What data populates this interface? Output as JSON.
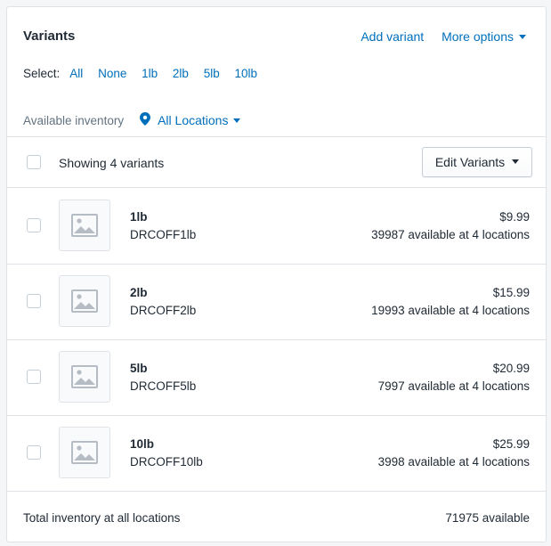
{
  "header": {
    "title": "Variants",
    "add_variant": "Add variant",
    "more_options": "More options"
  },
  "select": {
    "label": "Select:",
    "options": [
      "All",
      "None",
      "1lb",
      "2lb",
      "5lb",
      "10lb"
    ]
  },
  "inventory": {
    "label": "Available inventory",
    "location": "All Locations"
  },
  "list": {
    "showing": "Showing 4 variants",
    "edit_button": "Edit Variants"
  },
  "variants": [
    {
      "name": "1lb",
      "sku": "DRCOFF1lb",
      "price": "$9.99",
      "availability": "39987 available at 4 locations"
    },
    {
      "name": "2lb",
      "sku": "DRCOFF2lb",
      "price": "$15.99",
      "availability": "19993 available at 4 locations"
    },
    {
      "name": "5lb",
      "sku": "DRCOFF5lb",
      "price": "$20.99",
      "availability": "7997 available at 4 locations"
    },
    {
      "name": "10lb",
      "sku": "DRCOFF10lb",
      "price": "$25.99",
      "availability": "3998 available at 4 locations"
    }
  ],
  "footer": {
    "label": "Total inventory at all locations",
    "value": "71975 available"
  },
  "colors": {
    "link": "#006fbb",
    "border": "#dfe3e8",
    "text": "#212b36",
    "muted": "#637381"
  },
  "icons": {
    "location": "map-pin-icon",
    "placeholder": "image-placeholder-icon",
    "dropdown": "caret-down-icon"
  }
}
